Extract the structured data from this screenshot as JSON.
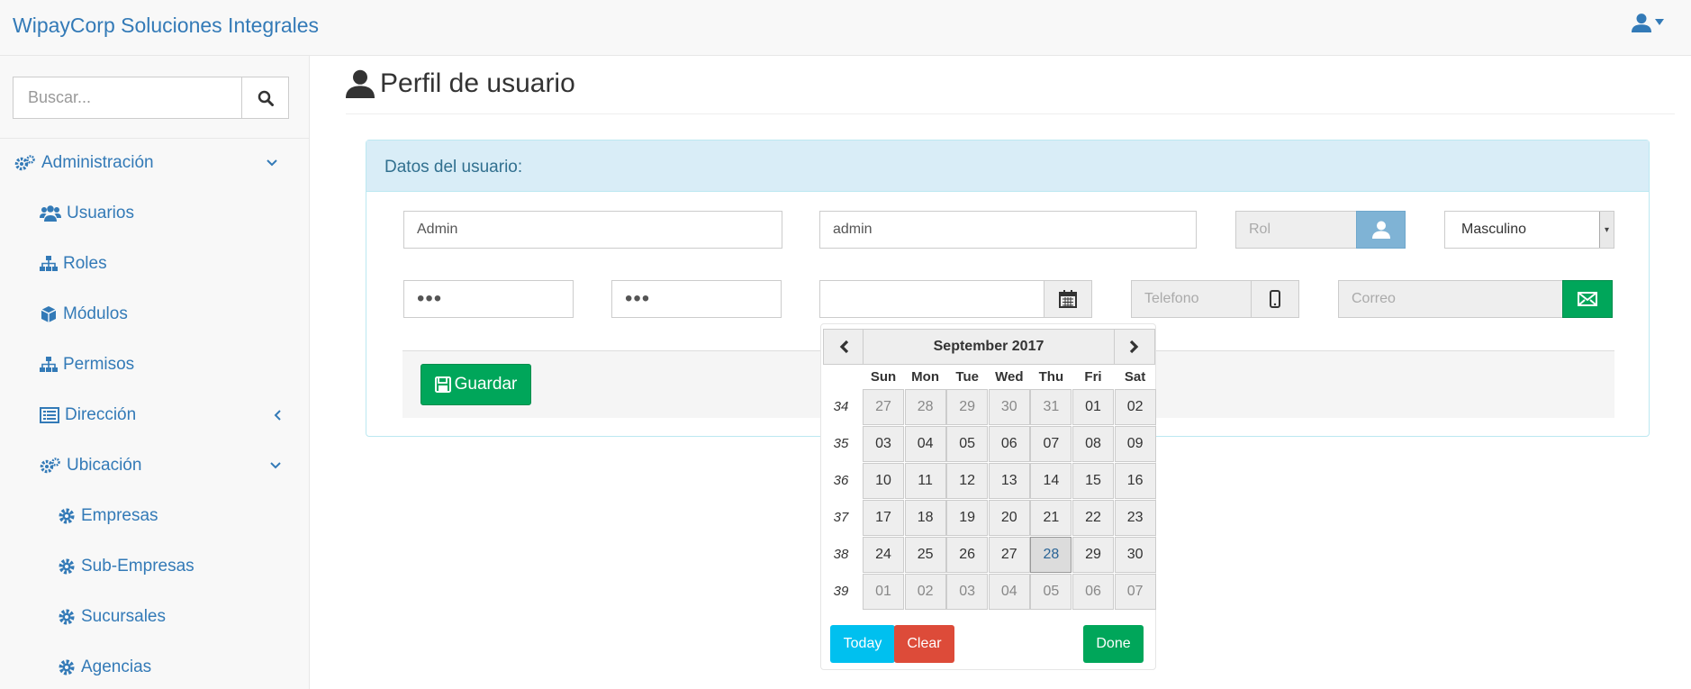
{
  "navbar": {
    "brand": "WipayCorp Soluciones Integrales",
    "user_icon": "user-icon"
  },
  "sidebar": {
    "search_placeholder": "Buscar...",
    "items": [
      {
        "label": "Administración",
        "icon": "cogs-icon"
      },
      {
        "label": "Usuarios",
        "icon": "users-icon"
      },
      {
        "label": "Roles",
        "icon": "sitemap-icon"
      },
      {
        "label": "Módulos",
        "icon": "cube-icon"
      },
      {
        "label": "Permisos",
        "icon": "sitemap-icon"
      },
      {
        "label": "Dirección",
        "icon": "list-alt-icon"
      },
      {
        "label": "Ubicación",
        "icon": "cogs-icon"
      },
      {
        "label": "Empresas",
        "icon": "cog-icon"
      },
      {
        "label": "Sub-Empresas",
        "icon": "cog-icon"
      },
      {
        "label": "Sucursales",
        "icon": "cog-icon"
      },
      {
        "label": "Agencias",
        "icon": "cog-icon"
      }
    ]
  },
  "main": {
    "title": "Perfil de usuario",
    "panel_title": "Datos del usuario:",
    "fields": {
      "nombre": "Admin",
      "usuario": "admin",
      "rol_placeholder": "Rol",
      "genero": "Masculino",
      "password": "•••",
      "password_confirm": "•••",
      "fecha": "",
      "telefono_placeholder": "Telefono",
      "correo_placeholder": "Correo"
    },
    "save_label": "Guardar"
  },
  "datepicker": {
    "title": "September 2017",
    "days_of_week": [
      "Sun",
      "Mon",
      "Tue",
      "Wed",
      "Thu",
      "Fri",
      "Sat"
    ],
    "weeks": [
      {
        "week": "34",
        "days": [
          "27",
          "28",
          "29",
          "30",
          "31",
          "01",
          "02"
        ]
      },
      {
        "week": "35",
        "days": [
          "03",
          "04",
          "05",
          "06",
          "07",
          "08",
          "09"
        ]
      },
      {
        "week": "36",
        "days": [
          "10",
          "11",
          "12",
          "13",
          "14",
          "15",
          "16"
        ]
      },
      {
        "week": "37",
        "days": [
          "17",
          "18",
          "19",
          "20",
          "21",
          "22",
          "23"
        ]
      },
      {
        "week": "38",
        "days": [
          "24",
          "25",
          "26",
          "27",
          "28",
          "29",
          "30"
        ]
      },
      {
        "week": "39",
        "days": [
          "01",
          "02",
          "03",
          "04",
          "05",
          "06",
          "07"
        ]
      }
    ],
    "today_label": "Today",
    "clear_label": "Clear",
    "done_label": "Done",
    "colors": {
      "today": "#00c0ef",
      "clear": "#dd4b39",
      "done": "#00a65a"
    }
  }
}
